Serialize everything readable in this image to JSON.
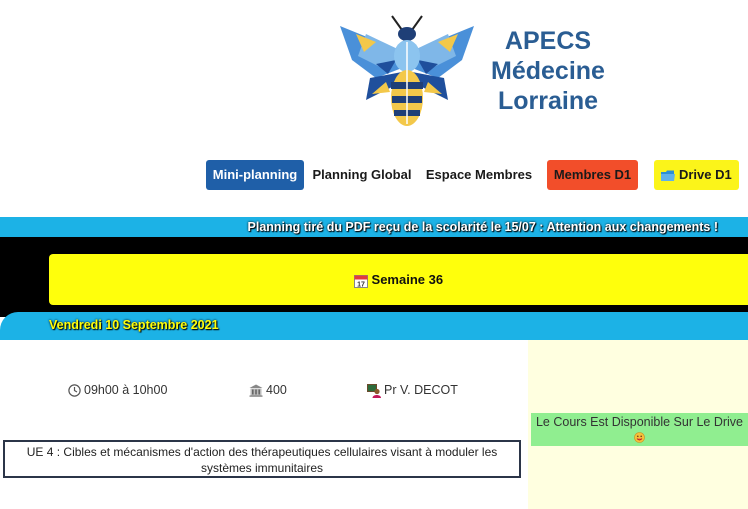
{
  "brand": {
    "line1": "APECS",
    "line2": "Médecine",
    "line3": "Lorraine"
  },
  "nav": {
    "mini_planning": "Mini-planning",
    "planning_global": "Planning Global",
    "espace_membres": "Espace Membres",
    "membres_d1": "Membres D1",
    "drive_d1": "Drive D1"
  },
  "notice": "Planning tiré du PDF reçu de la scolarité le 15/07 : Attention aux changements !",
  "week": {
    "label": "Semaine 36"
  },
  "day": {
    "label": "Vendredi 10 Septembre 2021"
  },
  "course": {
    "time": "09h00 à 10h00",
    "room": "400",
    "professor": "Pr V. DECOT",
    "title": "UE 4 : Cibles et mécanismes d'action des thérapeutiques cellulaires visant à moduler les systèmes immunitaires",
    "availability": "Le Cours Est Disponible Sur Le Drive"
  },
  "icons": {
    "logo": "bee-logo",
    "drive": "folder-icon",
    "week": "calendar-icon",
    "time": "clock-icon",
    "room": "building-icon",
    "professor": "teacher-icon",
    "availability": "smile-icon"
  },
  "colors": {
    "brand": "#2a5d93",
    "nav_active": "#1f5fa8",
    "membres": "#f24e2a",
    "drive": "#fbf41a",
    "banner": "#1cb2e6",
    "week_box": "#ffff0c",
    "panel": "#ffffe0",
    "available": "#90ee90"
  }
}
